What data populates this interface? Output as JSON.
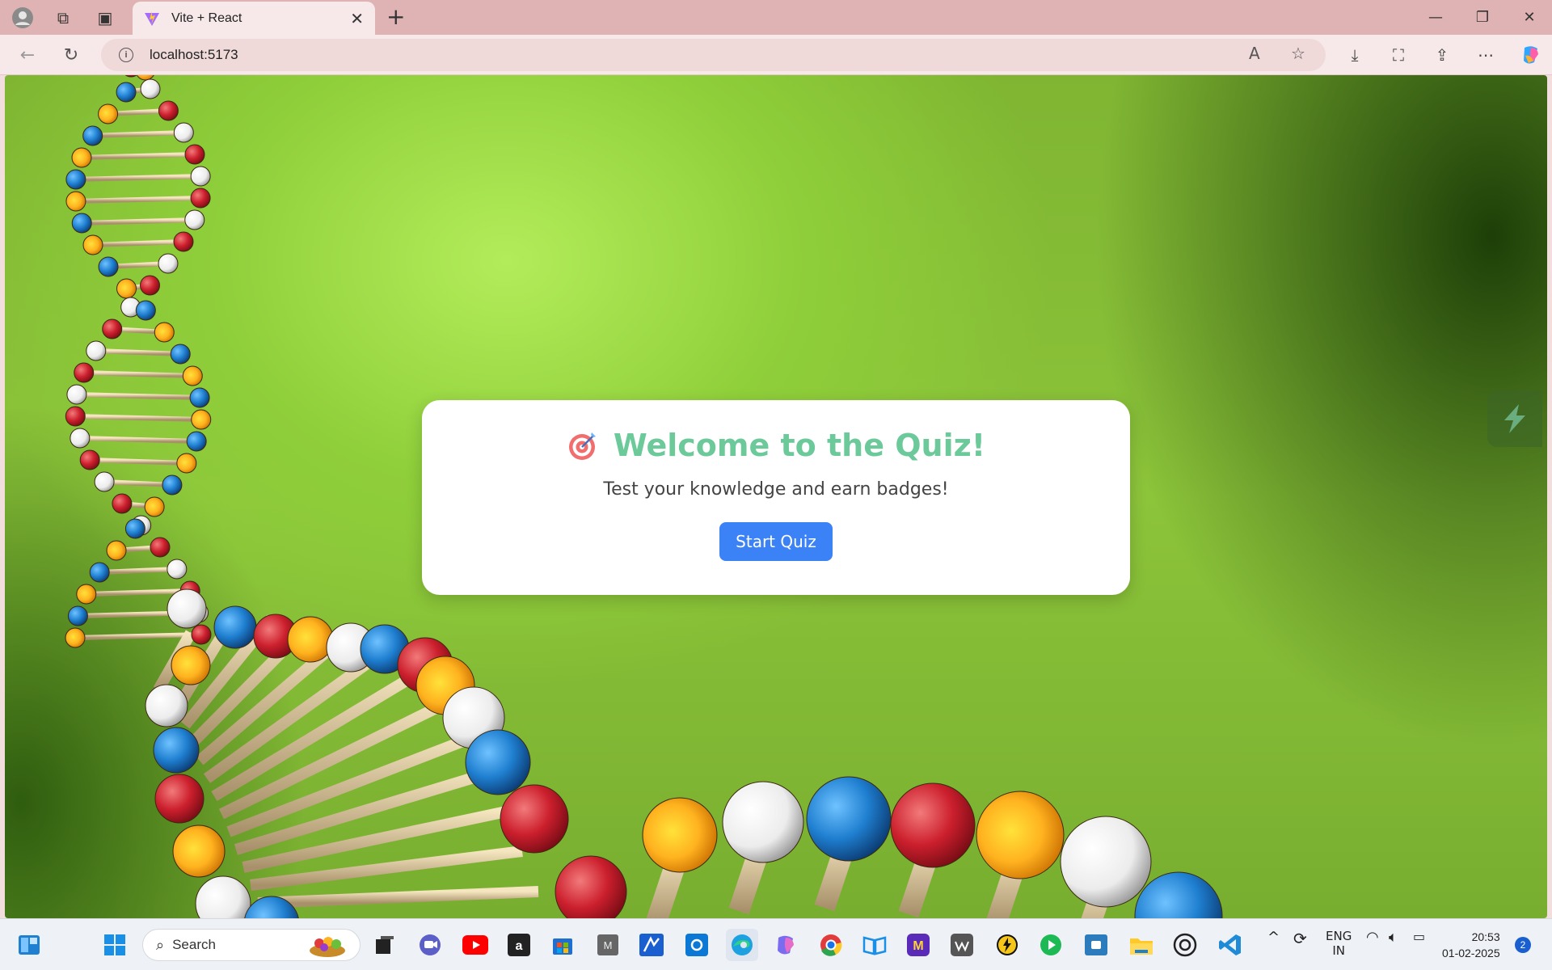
{
  "browser": {
    "tab_title": "Vite + React",
    "url": "localhost:5173"
  },
  "card": {
    "title": "Welcome to the Quiz!",
    "subtitle": "Test your knowledge and earn badges!",
    "start_button": "Start Quiz"
  },
  "taskbar": {
    "search_label": "Search",
    "lang_line1": "ENG",
    "lang_line2": "IN",
    "time": "20:53",
    "date": "01-02-2025",
    "notifications": "2"
  },
  "colors": {
    "title": "#6cc99a",
    "button": "#3b82f6",
    "background": "#8fcf3a"
  }
}
